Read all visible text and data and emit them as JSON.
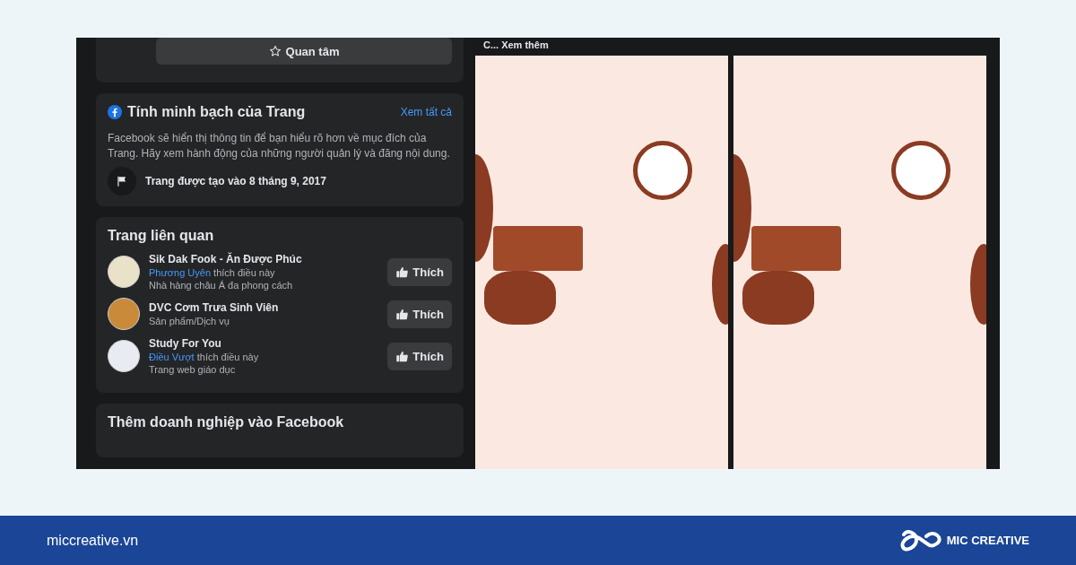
{
  "follow_card": {
    "button": "Quan tâm"
  },
  "transparency": {
    "title": "Tính minh bạch của Trang",
    "see_all": "Xem tất cả",
    "description": "Facebook sẽ hiển thị thông tin để bạn hiểu rõ hơn về mục đích của Trang. Hãy xem hành động của những người quản lý và đăng nội dung.",
    "created": "Trang được tạo vào 8 tháng 9, 2017"
  },
  "related_pages": {
    "title": "Trang liên quan",
    "items": [
      {
        "name": "Sik Dak Fook - Ăn Được Phúc",
        "friend": "Phương Uyên",
        "friend_action": "thích điều này",
        "category": "Nhà hàng châu Á đa phong cách",
        "button": "Thích",
        "color": "#e9e2c8"
      },
      {
        "name": "DVC Cơm Trưa Sinh Viên",
        "category": "Sản phẩm/Dịch vụ",
        "button": "Thích",
        "color": "#c98a3a"
      },
      {
        "name": "Study For You",
        "friend": "Điều Vượt",
        "friend_action": "thích điều này",
        "category": "Trang web giáo dục",
        "button": "Thích",
        "color": "#e8ecf2"
      }
    ]
  },
  "business_card": {
    "title": "Thêm doanh nghiệp vào Facebook"
  },
  "post": {
    "see_more": "C... Xem thêm",
    "images": [
      {
        "kind": "infographic"
      },
      {
        "kind": "infographic"
      }
    ]
  },
  "footer": {
    "site": "miccreative.vn",
    "brand": "MIC CREATIVE"
  }
}
